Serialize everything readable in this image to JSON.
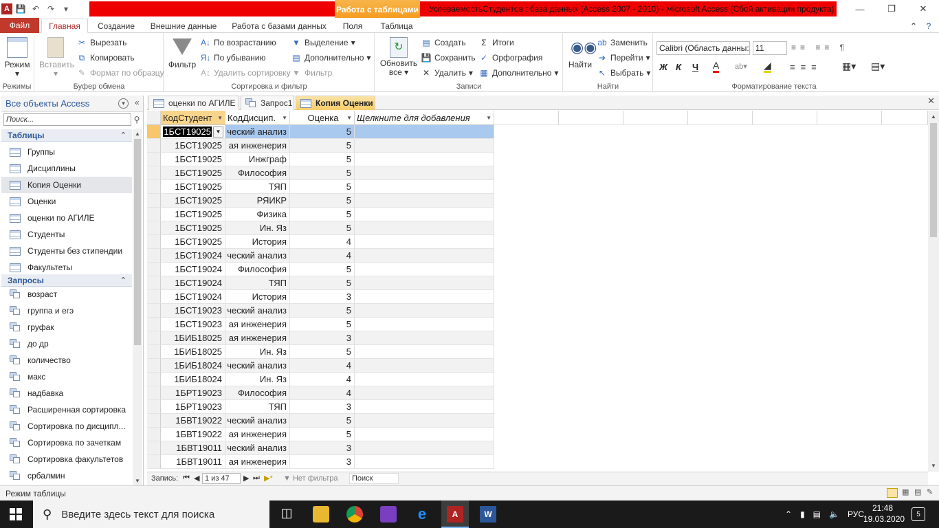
{
  "window": {
    "title": "УспеваемостьСтудентов : база данных (Access 2007 - 2010)  -  Microsoft Access (Сбой активации продукта)",
    "context_tab": "Работа с таблицами",
    "accent": "#c0392b"
  },
  "ribbon_tabs": [
    "Файл",
    "Главная",
    "Создание",
    "Внешние данные",
    "Работа с базами данных",
    "Поля",
    "Таблица"
  ],
  "ribbon": {
    "views": {
      "mode": "Режим",
      "group": "Режимы"
    },
    "clipboard": {
      "paste": "Вставить",
      "cut": "Вырезать",
      "copy": "Копировать",
      "format": "Формат по образцу",
      "group": "Буфер обмена"
    },
    "sort": {
      "filter": "Фильтр",
      "asc": "По возрастанию",
      "desc": "По убыванию",
      "remove": "Удалить сортировку",
      "selection": "Выделение",
      "advanced": "Дополнительно",
      "toggle": "Фильтр",
      "group": "Сортировка и фильтр"
    },
    "records": {
      "refresh_1": "Обновить",
      "refresh_2": "все",
      "new": "Создать",
      "save": "Сохранить",
      "delete": "Удалить",
      "totals": "Итоги",
      "spelling": "Орфография",
      "more": "Дополнительно",
      "group": "Записи"
    },
    "find": {
      "find": "Найти",
      "replace": "Заменить",
      "goto": "Перейти",
      "select": "Выбрать",
      "group": "Найти"
    },
    "text": {
      "font": "Calibri (Область данны:",
      "size": "11",
      "bold": "Ж",
      "italic": "К",
      "underline": "Ч",
      "group": "Форматирование текста"
    }
  },
  "nav": {
    "header": "Все объекты Access",
    "search_placeholder": "Поиск...",
    "tables_label": "Таблицы",
    "tables": [
      "Группы",
      "Дисциплины",
      "Копия Оценки",
      "Оценки",
      "оценки по АГИЛЕ",
      "Студенты",
      "Студенты без стипендии",
      "Факультеты"
    ],
    "queries_label": "Запросы",
    "queries": [
      "возраст",
      "группа и егэ",
      "груфак",
      "до др",
      "количество",
      "макс",
      "надбавка",
      "Расширенная сортировка",
      "Сортировка по дисципл...",
      "Сортировка по зачеткам",
      "Сортировка факультетов",
      "србалмин"
    ]
  },
  "doc_tabs": [
    "оценки по АГИЛЕ",
    "Запрос1",
    "Копия Оценки"
  ],
  "grid": {
    "columns": [
      "КодСтудент",
      "КодДисцип.",
      "Оценка",
      "Щелкните для добавления"
    ],
    "rows": [
      [
        "1БСТ19025",
        "ческий анализ",
        "5"
      ],
      [
        "1БСТ19025",
        "ая инженерия",
        "5"
      ],
      [
        "1БСТ19025",
        "Инжграф",
        "5"
      ],
      [
        "1БСТ19025",
        "Философия",
        "5"
      ],
      [
        "1БСТ19025",
        "ТЯП",
        "5"
      ],
      [
        "1БСТ19025",
        "РЯИКР",
        "5"
      ],
      [
        "1БСТ19025",
        "Физика",
        "5"
      ],
      [
        "1БСТ19025",
        "Ин. Яз",
        "5"
      ],
      [
        "1БСТ19025",
        "История",
        "4"
      ],
      [
        "1БСТ19024",
        "ческий анализ",
        "4"
      ],
      [
        "1БСТ19024",
        "Философия",
        "5"
      ],
      [
        "1БСТ19024",
        "ТЯП",
        "5"
      ],
      [
        "1БСТ19024",
        "История",
        "3"
      ],
      [
        "1БСТ19023",
        "ческий анализ",
        "5"
      ],
      [
        "1БСТ19023",
        "ая инженерия",
        "5"
      ],
      [
        "1БИБ18025",
        "ая инженерия",
        "3"
      ],
      [
        "1БИБ18025",
        "Ин. Яз",
        "5"
      ],
      [
        "1БИБ18024",
        "ческий анализ",
        "4"
      ],
      [
        "1БИБ18024",
        "Ин. Яз",
        "4"
      ],
      [
        "1БРТ19023",
        "Философия",
        "4"
      ],
      [
        "1БРТ19023",
        "ТЯП",
        "3"
      ],
      [
        "1БВТ19022",
        "ческий анализ",
        "5"
      ],
      [
        "1БВТ19022",
        "ая инженерия",
        "5"
      ],
      [
        "1БВТ19011",
        "ческий анализ",
        "3"
      ],
      [
        "1БВТ19011",
        "ая инженерия",
        "3"
      ]
    ]
  },
  "record_nav": {
    "label": "Запись:",
    "position": "1 из 47",
    "filter": "Нет фильтра",
    "search": "Поиск"
  },
  "status": {
    "mode": "Режим таблицы"
  },
  "taskbar": {
    "search_placeholder": "Введите здесь текст для поиска",
    "lang": "РУС",
    "time": "21:48",
    "date": "19.03.2020",
    "notifications": "5"
  }
}
